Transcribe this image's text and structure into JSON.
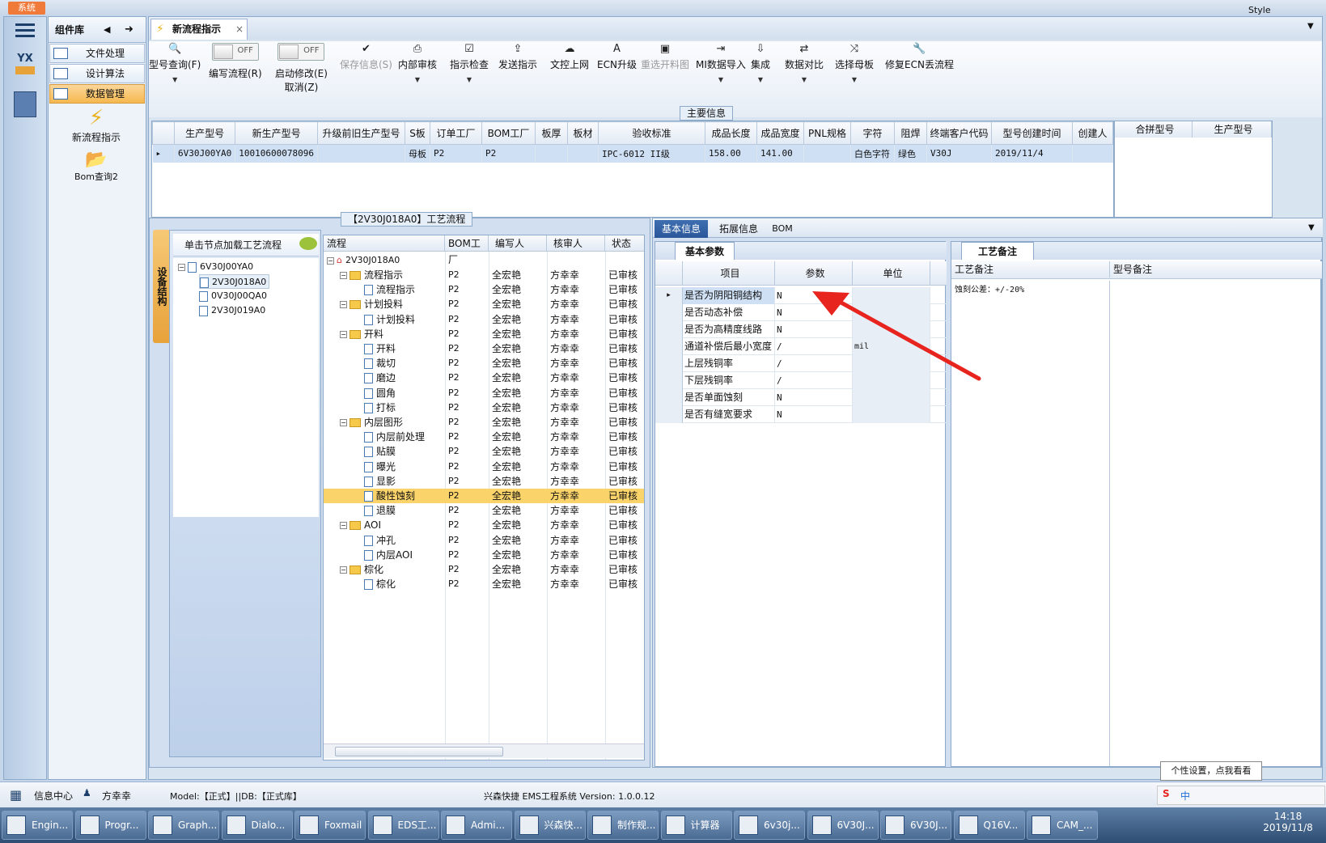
{
  "title_bar": {
    "system": "系统",
    "style": "Style"
  },
  "components": {
    "title": "组件库",
    "items": [
      "文件处理",
      "设计算法",
      "数据管理"
    ],
    "selected": 2,
    "tiles": [
      "新流程指示",
      "Bom查询2"
    ]
  },
  "tab": {
    "label": "新流程指示",
    "close": "×"
  },
  "toolbar": [
    {
      "label": "型号查询(F)",
      "icon": "search-icon",
      "dd": true,
      "disabled": false
    },
    {
      "label": "编写流程(R)",
      "toggle": "OFF"
    },
    {
      "label": "启动修改(E)",
      "label2": "取消(Z)",
      "toggle": "OFF"
    },
    {
      "label": "保存信息(S)",
      "icon": "check-icon",
      "disabled": true
    },
    {
      "label": "内部审核",
      "icon": "print-icon",
      "dd": true
    },
    {
      "label": "指示检查",
      "icon": "checkbox-icon",
      "dd": true
    },
    {
      "label": "发送指示",
      "icon": "upload-icon"
    },
    {
      "label": "文控上网",
      "icon": "cloud-upload-icon"
    },
    {
      "label": "ECN升级",
      "icon": "ecn-icon"
    },
    {
      "label": "重选开料图",
      "icon": "image-icon",
      "disabled": true
    },
    {
      "label": "MI数据导入",
      "icon": "import-icon",
      "dd": true
    },
    {
      "label": "集成",
      "icon": "download-icon",
      "dd": true
    },
    {
      "label": "数据对比",
      "icon": "compare-icon",
      "dd": true
    },
    {
      "label": "选择母板",
      "icon": "shuffle-icon",
      "dd": true
    },
    {
      "label": "修复ECN丢流程",
      "icon": "wrench-icon"
    }
  ],
  "main_info": {
    "title": "主要信息",
    "headers": [
      "生产型号",
      "新生产型号",
      "升级前旧生产型号",
      "S板",
      "订单工厂",
      "BOM工厂",
      "板厚",
      "板材",
      "验收标准",
      "成品长度",
      "成品宽度",
      "PNL规格",
      "字符",
      "阻焊",
      "终端客户代码",
      "型号创建时间",
      "创建人"
    ],
    "row": [
      "6V30J00YA0",
      "10010600078096",
      "",
      "母板",
      "P2",
      "P2",
      "",
      "",
      "IPC-6012 II级",
      "158.00",
      "141.00",
      "",
      "白色字符",
      "绿色",
      "V30J",
      "2019/11/4",
      ""
    ],
    "side_headers": [
      "合拼型号",
      "生产型号"
    ]
  },
  "device_tree": {
    "vertical_label": "设备结构",
    "header": "单击节点加载工艺流程",
    "root": "6V30J00YA0",
    "children": [
      "2V30J018A0",
      "0V30J00QA0",
      "2V30J019A0"
    ]
  },
  "flow": {
    "group_title": "【2V30J018A0】工艺流程",
    "headers": [
      "流程",
      "BOM工厂",
      "编写人",
      "核审人",
      "状态"
    ],
    "root": "2V30J018A0",
    "rows": [
      {
        "name": "流程指示",
        "level": 1,
        "folder": true
      },
      {
        "name": "流程指示",
        "level": 2
      },
      {
        "name": "计划投料",
        "level": 1,
        "folder": true
      },
      {
        "name": "计划投料",
        "level": 2
      },
      {
        "name": "开料",
        "level": 1,
        "folder": true
      },
      {
        "name": "开料",
        "level": 2
      },
      {
        "name": "裁切",
        "level": 2
      },
      {
        "name": "磨边",
        "level": 2
      },
      {
        "name": "圆角",
        "level": 2
      },
      {
        "name": "打标",
        "level": 2
      },
      {
        "name": "内层图形",
        "level": 1,
        "folder": true
      },
      {
        "name": "内层前处理",
        "level": 2
      },
      {
        "name": "贴膜",
        "level": 2
      },
      {
        "name": "曝光",
        "level": 2
      },
      {
        "name": "显影",
        "level": 2
      },
      {
        "name": "酸性蚀刻",
        "level": 2,
        "selected": true
      },
      {
        "name": "退膜",
        "level": 2
      },
      {
        "name": "AOI",
        "level": 1,
        "folder": true
      },
      {
        "name": "冲孔",
        "level": 2
      },
      {
        "name": "内层AOI",
        "level": 2
      },
      {
        "name": "棕化",
        "level": 1,
        "folder": true
      },
      {
        "name": "棕化",
        "level": 2
      }
    ],
    "bom": "P2",
    "writer": "全宏艳",
    "reviewer": "方幸幸",
    "status": "已审核"
  },
  "right_tabs": [
    "基本信息",
    "拓展信息",
    "BOM"
  ],
  "basic": {
    "tab": "基本参数",
    "headers": [
      "项目",
      "参数",
      "单位"
    ],
    "rows": [
      [
        "是否为阴阳铜结构",
        "N",
        ""
      ],
      [
        "是否动态补偿",
        "N",
        ""
      ],
      [
        "是否为高精度线路",
        "N",
        ""
      ],
      [
        "通道补偿后最小宽度",
        "/",
        "mil"
      ],
      [
        "上层残铜率",
        "/",
        ""
      ],
      [
        "下层残铜率",
        "/",
        ""
      ],
      [
        "是否单面蚀刻",
        "N",
        ""
      ],
      [
        "是否有缝宽要求",
        "N",
        ""
      ]
    ]
  },
  "process_note": {
    "tab": "工艺备注",
    "col1": "工艺备注",
    "col2": "型号备注",
    "content": "蚀刻公差：+/-20%"
  },
  "status": {
    "info_center": "信息中心",
    "user": "方幸幸",
    "model": "Model:【正式】||DB:【正式库】",
    "system": "兴森快捷 EMS工程系统 Version: 1.0.0.12",
    "tooltip": "个性设置，点我看看"
  },
  "taskbar": {
    "items": [
      "Engin...",
      "Progr...",
      "Graph...",
      "Dialo...",
      "Foxmail",
      "EDS工...",
      "Admi...",
      "兴森快...",
      "制作规...",
      "计算器",
      "6v30j...",
      "6V30J...",
      "6V30J...",
      "Q16V...",
      "CAM_..."
    ],
    "ime": "中",
    "time": "14:18",
    "date": "2019/11/8"
  },
  "colors": {
    "selected_row": "#fad46b",
    "accent": "#f6b84f",
    "arrow": "#e8241f"
  }
}
